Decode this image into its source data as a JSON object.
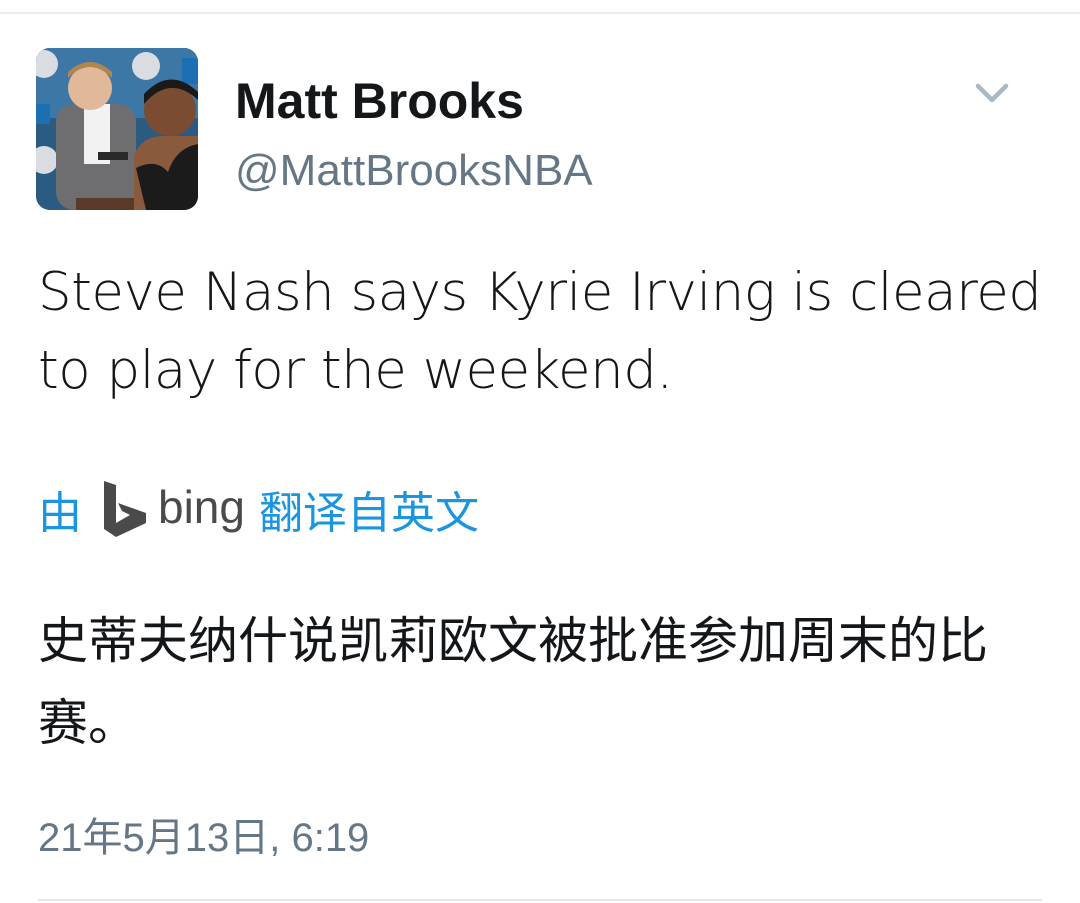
{
  "tweet": {
    "author": {
      "display_name": "Matt Brooks",
      "handle": "@MattBrooksNBA",
      "avatar_icon": "profile-photo"
    },
    "menu_icon": "chevron-down-icon",
    "text": "Steve Nash says Kyrie Irving is cleared to play for the weekend.",
    "translation": {
      "prefix": "由",
      "provider": "bing",
      "suffix": "翻译自英文",
      "text": "史蒂夫纳什说凯莉欧文被批准参加周末的比赛。"
    },
    "timestamp": "21年5月13日, 6:19"
  },
  "colors": {
    "link": "#1b95e0",
    "secondary_text": "#657786",
    "primary_text": "#14171a",
    "divider": "#e1e8ed"
  }
}
